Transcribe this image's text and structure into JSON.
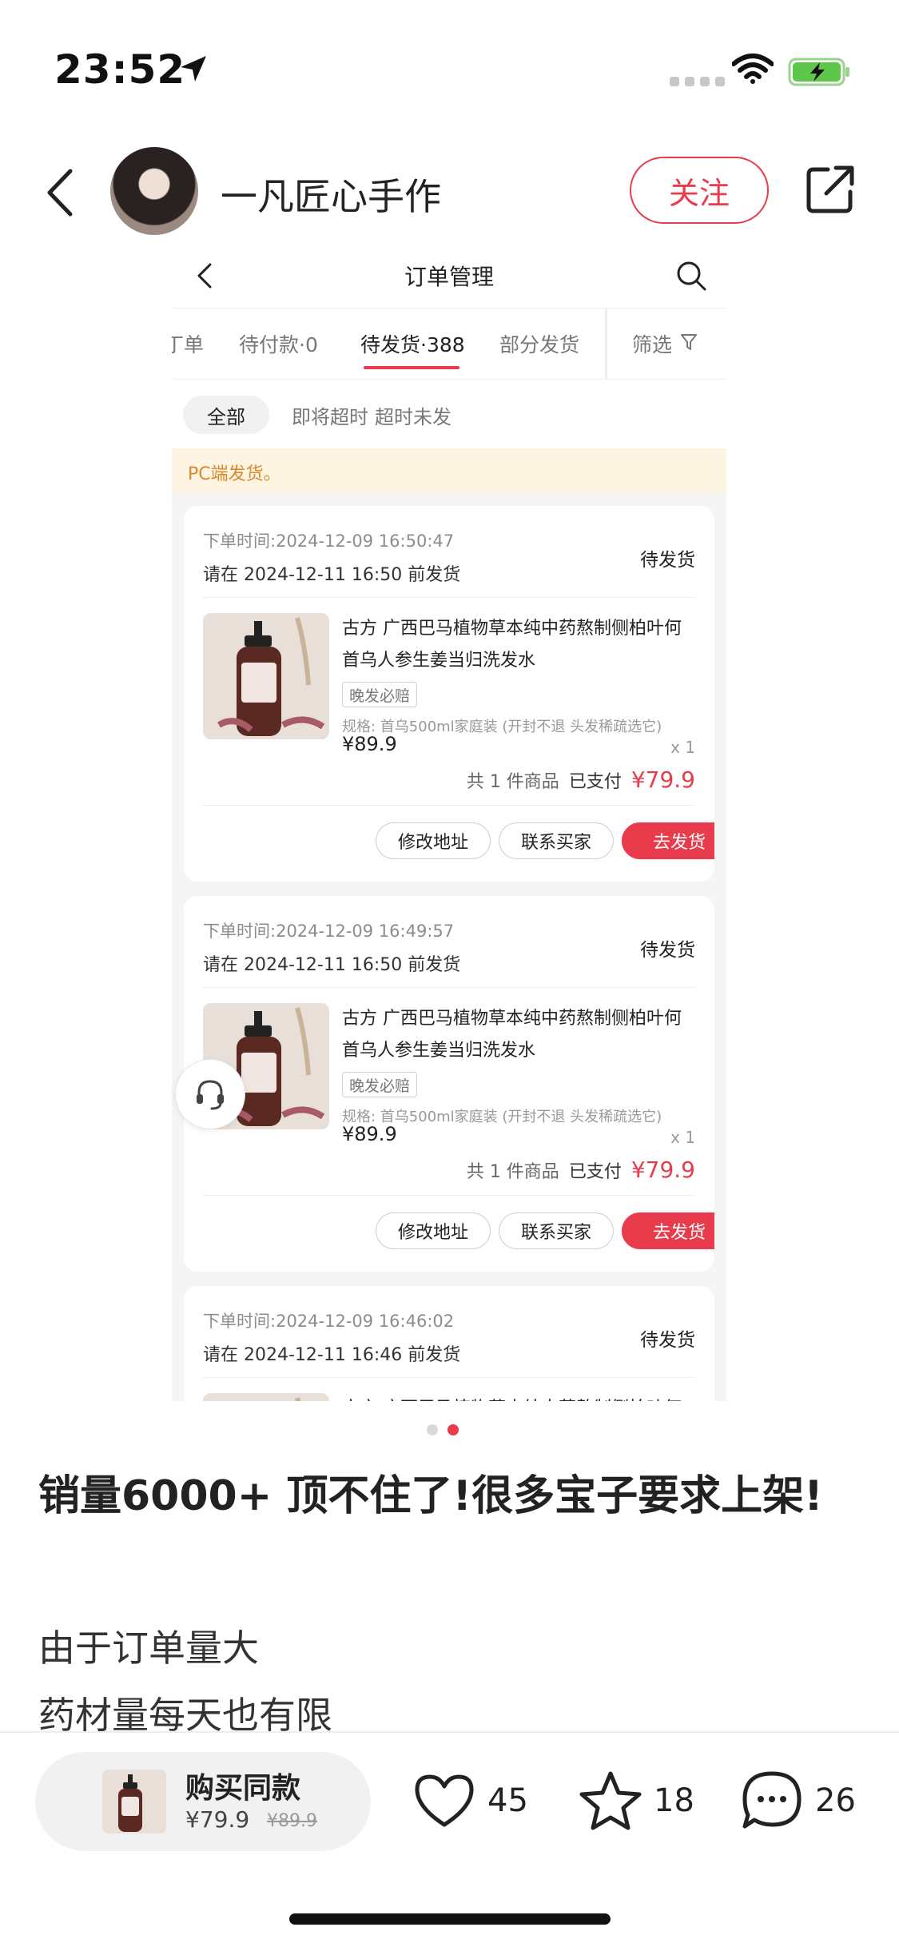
{
  "status_bar": {
    "time": "23:52"
  },
  "post_header": {
    "author": "一凡匠心手作",
    "follow_label": "关注"
  },
  "screenshot": {
    "nav_title": "订单管理",
    "tabs": [
      {
        "label": "丁单"
      },
      {
        "label": "待付款·0"
      },
      {
        "label": "待发货·388",
        "active": true
      },
      {
        "label": "部分发货"
      }
    ],
    "filter_label": "筛选",
    "chips": [
      {
        "label": "全部",
        "active": true
      },
      {
        "label": "即将超时"
      },
      {
        "label": "超时未发"
      }
    ],
    "notice": "PC端发货。",
    "orders": [
      {
        "order_time_label": "下单时间:",
        "order_time": "2024-12-09 16:50:47",
        "deadline": "请在 2024-12-11 16:50 前发货",
        "status": "待发货",
        "product_name": "古方 广西巴马植物草本纯中药熬制侧柏叶何首乌人参生姜当归洗发水",
        "tag": "晚发必赔",
        "spec": "规格: 首乌500ml家庭装 (开封不退 头发稀疏选它)",
        "price": "¥89.9",
        "qty": "x 1",
        "count_text": "共 1 件商品",
        "paid_label": "已支付",
        "paid_amount": "¥79.9",
        "btn_address": "修改地址",
        "btn_contact": "联系买家",
        "btn_ship": "去发货"
      },
      {
        "order_time_label": "下单时间:",
        "order_time": "2024-12-09 16:49:57",
        "deadline": "请在 2024-12-11 16:50 前发货",
        "status": "待发货",
        "product_name": "古方 广西巴马植物草本纯中药熬制侧柏叶何首乌人参生姜当归洗发水",
        "tag": "晚发必赔",
        "spec": "规格: 首乌500ml家庭装 (开封不退 头发稀疏选它)",
        "price": "¥89.9",
        "qty": "x 1",
        "count_text": "共 1 件商品",
        "paid_label": "已支付",
        "paid_amount": "¥79.9",
        "btn_address": "修改地址",
        "btn_contact": "联系买家",
        "btn_ship": "去发货"
      },
      {
        "order_time_label": "下单时间:",
        "order_time": "2024-12-09 16:46:02",
        "deadline": "请在 2024-12-11 16:46 前发货",
        "status": "待发货",
        "product_name": "古方 广西巴马植物草本纯中药熬制侧柏叶何",
        "tag": "",
        "spec": "",
        "price": "",
        "qty": "",
        "count_text": "",
        "paid_label": "",
        "paid_amount": "",
        "btn_address": "",
        "btn_contact": "",
        "btn_ship": ""
      }
    ]
  },
  "pager": {
    "count": 2,
    "active_index": 1
  },
  "post": {
    "title": "销量6000+ 顶不住了!很多宝子要求上架!",
    "body_lines": [
      "由于订单量大",
      "药材量每天也有限"
    ]
  },
  "bottom_bar": {
    "buy_label": "购买同款",
    "buy_price": "¥79.9",
    "buy_original_price": "¥89.9",
    "likes": "45",
    "favorites": "18",
    "comments": "26"
  },
  "colors": {
    "accent": "#e83b4b",
    "notice_bg": "#fdf5e2",
    "notice_text": "#d9892c"
  },
  "icons": [
    "location-arrow-icon",
    "wifi-icon",
    "battery-charging-icon",
    "back-icon",
    "share-icon",
    "search-icon",
    "filter-icon",
    "customer-service-icon",
    "heart-icon",
    "star-icon",
    "comment-icon"
  ]
}
